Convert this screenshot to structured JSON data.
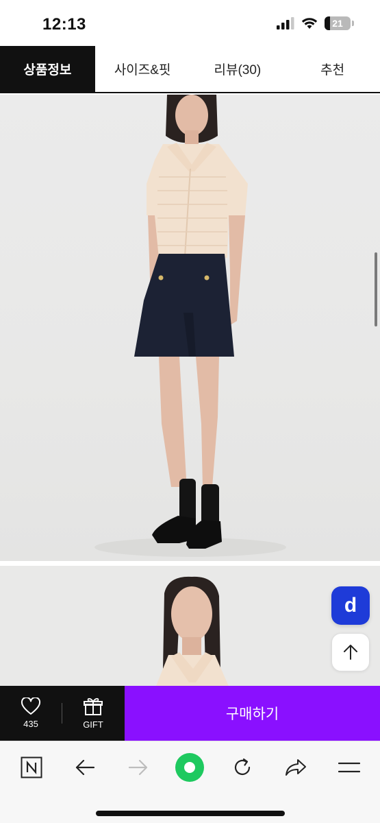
{
  "status_bar": {
    "time": "12:13",
    "battery": "21",
    "battery_level_percent": 21
  },
  "tabs": [
    {
      "label": "상품정보",
      "active": true
    },
    {
      "label": "사이즈&핏",
      "active": false
    },
    {
      "label": "리뷰(30)",
      "active": false
    },
    {
      "label": "추천",
      "active": false
    }
  ],
  "floating": {
    "d_button_label": "d",
    "scroll_top_icon": "arrow-up-icon"
  },
  "purchase_bar": {
    "like_count": "435",
    "gift_label": "GIFT",
    "buy_label": "구매하기"
  },
  "browser_bar": {
    "icons": [
      "naver-n-icon",
      "back-arrow-icon",
      "forward-arrow-icon",
      "green-dot-icon",
      "refresh-icon",
      "share-icon",
      "menu-icon"
    ]
  },
  "colors": {
    "active_tab_bg": "#111111",
    "buy_button": "#8a10ff",
    "d_button": "#1e3bd8",
    "green_dot": "#1ec95f"
  }
}
